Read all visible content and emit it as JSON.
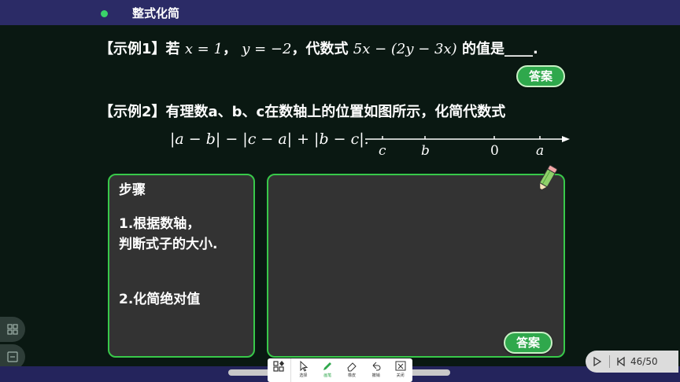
{
  "header": {
    "title": "整式化简"
  },
  "example1": {
    "prefix": "【示例1】若",
    "x_eq": "x = 1",
    "sep1": "，",
    "y_eq": "y = −2",
    "sep2": "，代数式",
    "expr": "5x − (2y − 3x)",
    "suffix": "的值是____."
  },
  "answer_btn_1": "答案",
  "example2": {
    "line1": "【示例2】有理数a、b、c在数轴上的位置如图所示，化简代数式",
    "line2": "|a − b| − |c − a| + |b − c|."
  },
  "number_line": {
    "labels": [
      "c",
      "b",
      "0",
      "a"
    ]
  },
  "steps_panel": {
    "heading": "步骤",
    "step1_line1": "1.根据数轴，",
    "step1_line2": "判断式子的大小.",
    "step2": "2.化简绝对值"
  },
  "answer_btn_2": "答案",
  "toolbar": {
    "items": [
      {
        "label": "选择",
        "icon": "cursor-icon"
      },
      {
        "label": "画笔",
        "icon": "pen-icon"
      },
      {
        "label": "橡皮",
        "icon": "eraser-icon"
      },
      {
        "label": "撤销",
        "icon": "undo-icon"
      },
      {
        "label": "关闭",
        "icon": "close-icon"
      }
    ]
  },
  "pager": {
    "page_text": "46/50"
  },
  "colors": {
    "accent_green": "#38c94a",
    "button_green": "#2fa84c",
    "header_bg": "#2b2b66",
    "slide_bg": "#0a1812"
  }
}
